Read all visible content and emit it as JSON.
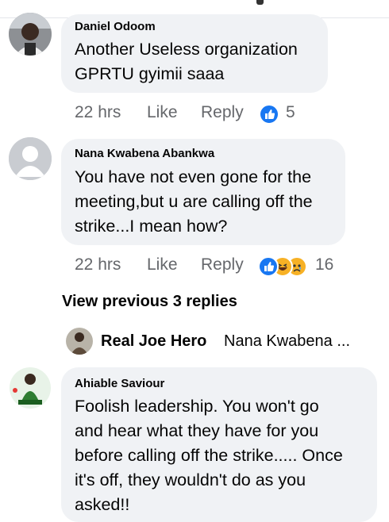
{
  "comments": [
    {
      "author": "Daniel Odoom",
      "text_lines": [
        "Another Useless organization",
        "GPRTU gyimii saaa"
      ],
      "time": "22 hrs",
      "like_label": "Like",
      "reply_label": "Reply",
      "reaction_icons": [
        "like-icon"
      ],
      "reaction_count": "5"
    },
    {
      "author": "Nana Kwabena Abankwa",
      "text_lines": [
        "You have not even gone for the",
        "meeting,but u are calling off the",
        "strike...I mean how?"
      ],
      "time": "22 hrs",
      "like_label": "Like",
      "reply_label": "Reply",
      "reaction_icons": [
        "like-icon",
        "haha-icon",
        "sad-icon"
      ],
      "reaction_count": "16"
    },
    {
      "author": "Ahiable Saviour",
      "text_lines": [
        "Foolish leadership. You won't go",
        "and hear what they have for you",
        "before calling off the strike..... Once",
        "it's off, they wouldn't do as you",
        "asked!!"
      ]
    }
  ],
  "view_previous": "View previous 3 replies",
  "reply_preview": {
    "author": "Real Joe Hero",
    "text": "Nana Kwabena ..."
  },
  "colors": {
    "bubble": "#f0f2f5",
    "secondary_text": "#65676b",
    "like_blue": "#1877f2"
  }
}
